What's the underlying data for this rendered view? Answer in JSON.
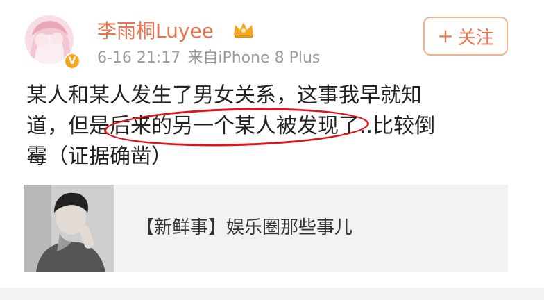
{
  "user": {
    "name": "李雨桐Luyee",
    "badge": "V"
  },
  "post": {
    "date": "6-16 21:17",
    "source": "来自iPhone 8 Plus",
    "line1": "某人和某人发生了男女关系，这事我早就知",
    "line2_before": "道，但是",
    "line2_highlight": "后来的另一个某人被发现了",
    "line2_after": "..比较倒",
    "line3": "霉（证据确凿）"
  },
  "follow_button": {
    "plus": "+",
    "label": "关注"
  },
  "card": {
    "title": "【新鲜事】娱乐圈那些事儿"
  },
  "colors": {
    "username": "#eb7350",
    "meta": "#9a9a9a",
    "highlight_ring": "#e0141e",
    "verified_badge": "#f5a623",
    "card_bg": "#f2f2f2"
  },
  "icons": [
    "crown-icon",
    "verified-badge-icon",
    "plus-icon"
  ]
}
